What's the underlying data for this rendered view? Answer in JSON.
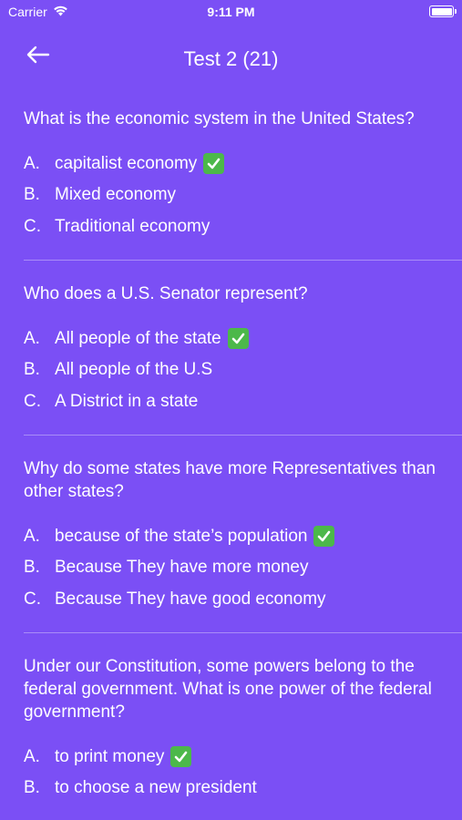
{
  "status": {
    "carrier": "Carrier",
    "time": "9:11 PM"
  },
  "header": {
    "title": "Test 2 (21)"
  },
  "questions": [
    {
      "text": "What is the economic system in the United States?",
      "answers": [
        {
          "letter": "A.",
          "text": "capitalist economy",
          "correct": true
        },
        {
          "letter": "B.",
          "text": "Mixed economy",
          "correct": false
        },
        {
          "letter": "C.",
          "text": "Traditional economy",
          "correct": false
        }
      ]
    },
    {
      "text": "Who does a U.S. Senator represent?",
      "answers": [
        {
          "letter": "A.",
          "text": "All people of the state",
          "correct": true
        },
        {
          "letter": "B.",
          "text": "All people of the U.S",
          "correct": false
        },
        {
          "letter": "C.",
          "text": "A District in a state",
          "correct": false
        }
      ]
    },
    {
      "text": "Why do some states have more Representatives than other states?",
      "answers": [
        {
          "letter": "A.",
          "text": "because of the state’s population",
          "correct": true
        },
        {
          "letter": "B.",
          "text": "Because They have more money",
          "correct": false
        },
        {
          "letter": "C.",
          "text": "Because They have good economy",
          "correct": false
        }
      ]
    },
    {
      "text": "Under our Constitution, some powers belong to the federal government. What is one power of the federal government?",
      "answers": [
        {
          "letter": "A.",
          "text": "to print money",
          "correct": true
        },
        {
          "letter": "B.",
          "text": "to choose a new president",
          "correct": false
        }
      ]
    }
  ]
}
